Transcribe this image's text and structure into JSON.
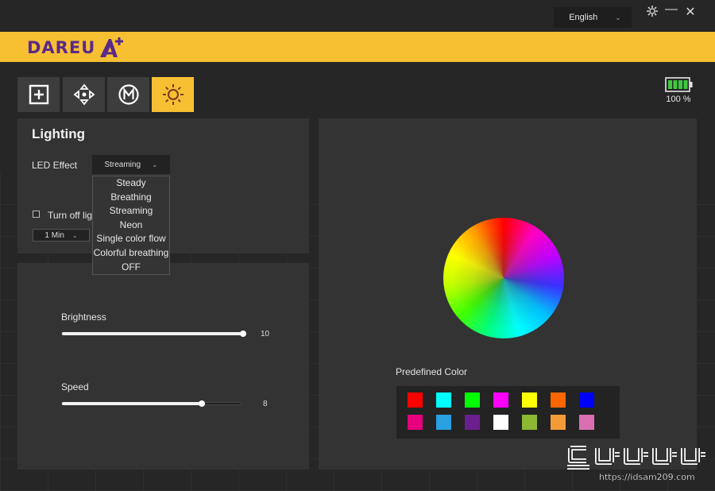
{
  "title_bar": {
    "language": "English",
    "settings_icon": "gear-icon",
    "minimize_icon": "minimize-icon",
    "close_icon": "close-icon"
  },
  "brand": {
    "logo_text": "DAREU",
    "logo_mark": "A+",
    "brand_color": "#f7bf32",
    "logo_color": "#5a2a8a"
  },
  "tabs": [
    {
      "name": "key-assignment",
      "icon": "plus-square-icon",
      "active": false
    },
    {
      "name": "dpi",
      "icon": "move-arrows-icon",
      "active": false
    },
    {
      "name": "macro",
      "icon": "macro-m-icon",
      "active": false
    },
    {
      "name": "lighting",
      "icon": "sun-icon",
      "active": true
    }
  ],
  "battery": {
    "percent": 100,
    "label": "100 %",
    "color": "#3ec93e"
  },
  "lighting": {
    "heading": "Lighting",
    "led_effect_label": "LED Effect",
    "led_effect_value": "Streaming",
    "options": [
      "Steady",
      "Breathing",
      "Streaming",
      "Neon",
      "Single color flow",
      "Colorful breathing",
      "OFF"
    ],
    "turn_off_label": "Turn off ligh",
    "timeout_value": "1 Min",
    "turn_off_checked": false
  },
  "sliders": {
    "brightness": {
      "label": "Brightness",
      "value": "10",
      "fraction": 1.0
    },
    "speed": {
      "label": "Speed",
      "value": "8",
      "fraction": 0.77
    }
  },
  "color": {
    "predefined_label": "Predefined Color",
    "swatches": [
      [
        "#ff0000",
        "#00ffff",
        "#00ff00",
        "#ff00ff",
        "#ffff00",
        "#ff6600",
        "#0000ff"
      ],
      [
        "#e6007e",
        "#29a0e0",
        "#6a1f8e",
        "#ffffff",
        "#8cb832",
        "#f39b36",
        "#d96fb0"
      ]
    ]
  },
  "watermark": {
    "text": "https://idsam209.com"
  }
}
